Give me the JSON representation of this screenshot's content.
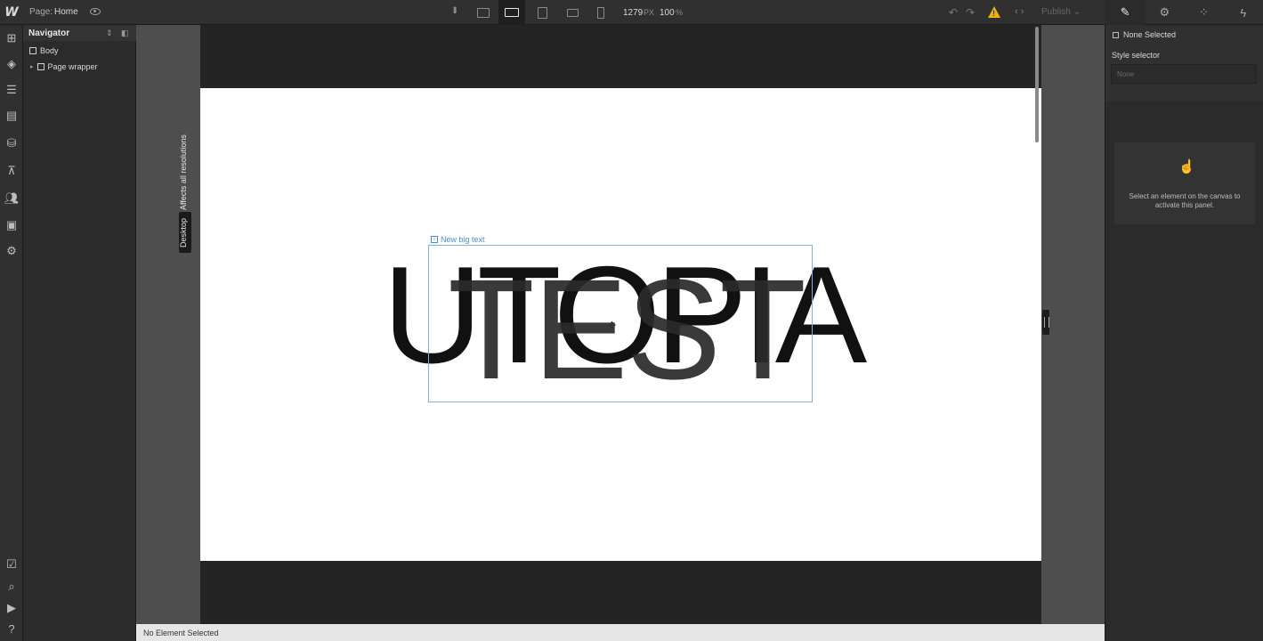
{
  "app": {
    "logo": "W",
    "page_label": "Page:",
    "page_name": "Home"
  },
  "toolbar": {
    "canvas_width": "1279",
    "width_unit": "PX",
    "zoom": "100",
    "zoom_unit": "%",
    "publish_label": "Publish",
    "devices": [
      "desktop-icon",
      "laptop-star-icon",
      "tablet-icon",
      "mobile-landscape-icon",
      "mobile-portrait-icon"
    ],
    "warning_color": "#f0b400"
  },
  "right_tabs": [
    "paintbrush-icon",
    "gear-icon",
    "drops-icon",
    "lightning-icon"
  ],
  "left_sidebar": {
    "top_icons": [
      "add-icon",
      "cube-icon",
      "navigator-icon",
      "pages-icon",
      "database-icon",
      "sitemap-icon",
      "users-icon",
      "assets-icon",
      "settings-icon"
    ],
    "bottom_icons": [
      "checklist-icon",
      "search-icon",
      "video-icon",
      "help-icon"
    ]
  },
  "navigator": {
    "title": "Navigator",
    "items": [
      {
        "label": "Body"
      },
      {
        "label": "Page wrapper"
      }
    ]
  },
  "canvas": {
    "breakpoint_note": "Affects all resolutions",
    "breakpoint_name": "Desktop",
    "element_label": "New big text",
    "text_layer_1": "UTOPIA",
    "text_layer_2": "TEST",
    "selection_color": "#7fb0e8"
  },
  "status": {
    "text": "No Element Selected"
  },
  "style_panel": {
    "none_selected": "None Selected",
    "style_selector_label": "Style selector",
    "style_selector_placeholder": "None",
    "activate_message": "Select an element on the canvas to activate this panel."
  }
}
